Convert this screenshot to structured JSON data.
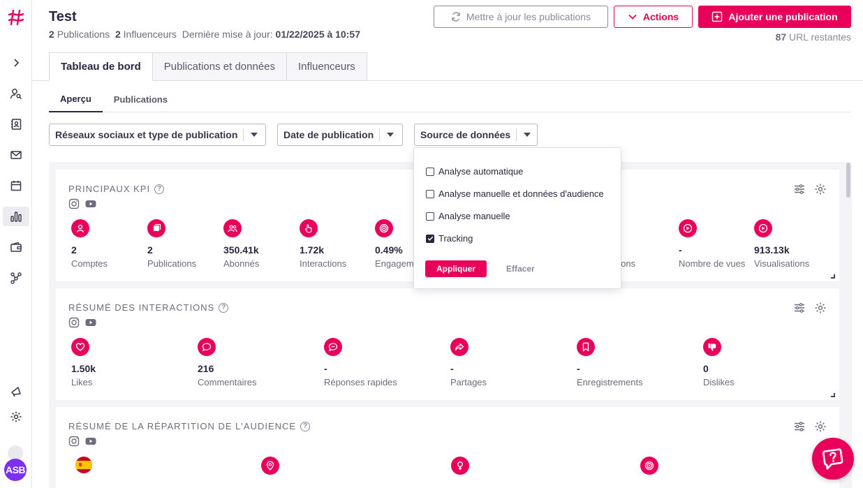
{
  "header": {
    "title": "Test",
    "publications_count": "2",
    "publications_label": "Publications",
    "influencers_count": "2",
    "influencers_label": "Influenceurs",
    "last_update_label": "Dernière mise à jour:",
    "last_update_value": "01/22/2025 à 10:57",
    "refresh_label": "Mettre à jour les publications",
    "actions_label": "Actions",
    "add_label": "Ajouter une publication",
    "url_count": "87",
    "url_label": "URL restantes"
  },
  "tabs": [
    {
      "label": "Tableau de bord",
      "active": true
    },
    {
      "label": "Publications et données",
      "active": false
    },
    {
      "label": "Influenceurs",
      "active": false
    }
  ],
  "subtabs": [
    {
      "label": "Aperçu",
      "active": true
    },
    {
      "label": "Publications",
      "active": false
    }
  ],
  "filters": {
    "social": "Réseaux sociaux et type de publication",
    "date": "Date de publication",
    "source": "Source de données"
  },
  "dropdown": {
    "options": [
      {
        "label": "Analyse automatique",
        "checked": false
      },
      {
        "label": "Analyse manuelle et données d'audience",
        "checked": false
      },
      {
        "label": "Analyse manuelle",
        "checked": false
      },
      {
        "label": "Tracking",
        "checked": true
      }
    ],
    "apply_label": "Appliquer",
    "clear_label": "Effacer"
  },
  "kpi_card": {
    "title": "PRINCIPAUX KPI",
    "items": [
      {
        "value": "2",
        "label": "Comptes",
        "icon": "user-icon"
      },
      {
        "value": "2",
        "label": "Publications",
        "icon": "publication-icon"
      },
      {
        "value": "350.41k",
        "label": "Abonnés",
        "icon": "followers-icon"
      },
      {
        "value": "1.72k",
        "label": "Interactions",
        "icon": "hand-pointer-icon"
      },
      {
        "value": "0.49%",
        "label": "Engagement",
        "icon": "target-icon"
      },
      {
        "value": "",
        "label": "Impressions",
        "icon": "eye-icon"
      },
      {
        "value": "-",
        "label": "Nombre de vues",
        "icon": "play-icon"
      },
      {
        "value": "913.13k",
        "label": "Visualisations",
        "icon": "play-icon"
      }
    ]
  },
  "interactions_card": {
    "title": "RÉSUMÉ DES INTERACTIONS",
    "items": [
      {
        "value": "1.50k",
        "label": "Likes",
        "icon": "heart-icon"
      },
      {
        "value": "216",
        "label": "Commentaires",
        "icon": "comment-icon"
      },
      {
        "value": "-",
        "label": "Réponses rapides",
        "icon": "quick-reply-icon"
      },
      {
        "value": "-",
        "label": "Partages",
        "icon": "share-icon"
      },
      {
        "value": "-",
        "label": "Enregistrements",
        "icon": "bookmark-icon"
      },
      {
        "value": "0",
        "label": "Dislikes",
        "icon": "thumbs-down-icon"
      }
    ]
  },
  "audience_card": {
    "title": "RÉSUMÉ DE LA RÉPARTITION DE L'AUDIENCE"
  },
  "user": {
    "initials": "ASB"
  },
  "colors": {
    "accent": "#e8005a",
    "avatar": "#7a2ff2"
  }
}
